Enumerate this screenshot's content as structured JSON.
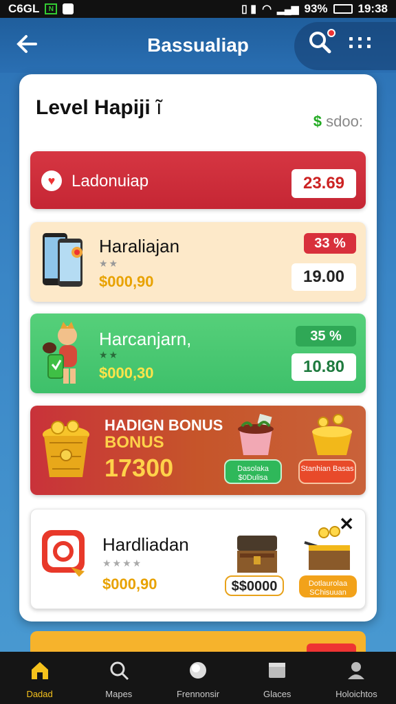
{
  "status_bar": {
    "carrier": "C6GL",
    "battery": "93%",
    "time": "19:38"
  },
  "header": {
    "title": "Bassualiap"
  },
  "card": {
    "title": "Level Hapiji",
    "balance_currency": "$",
    "balance_value": "sdoo:"
  },
  "rows": {
    "featured": {
      "label": "Ladonuiap",
      "price": "23.69"
    },
    "item1": {
      "name": "Haraliajan",
      "price": "$000,90",
      "discount": "33 %",
      "value": "19.00",
      "stars": "★★"
    },
    "item2": {
      "name": "Harcanjarn,",
      "price": "$000,30",
      "discount": "35 %",
      "value": "10.80",
      "stars": "★★"
    },
    "bonus": {
      "title": "HADIGN BONUS",
      "subtitle": "BONUS",
      "amount": "17300",
      "btn_green": "Dasolaka $0Dulisa",
      "btn_red": "Stanhian Basas"
    },
    "promo": {
      "name": "Hardliadan",
      "stars": "★★★★",
      "price": "$000,90",
      "chest_price": "$$0000",
      "chest_btn": "Dotlaurolaa SChisuuan"
    }
  },
  "nav": [
    {
      "label": "Dadad",
      "icon": "home-icon"
    },
    {
      "label": "Mapes",
      "icon": "search-icon"
    },
    {
      "label": "Frennonsir",
      "icon": "globe-icon"
    },
    {
      "label": "Glaces",
      "icon": "box-icon"
    },
    {
      "label": "Holoichtos",
      "icon": "profile-icon"
    }
  ],
  "colors": {
    "accent": "#2a6fb3",
    "active": "#f6c21c",
    "red": "#d63642",
    "green": "#3ec06a"
  }
}
